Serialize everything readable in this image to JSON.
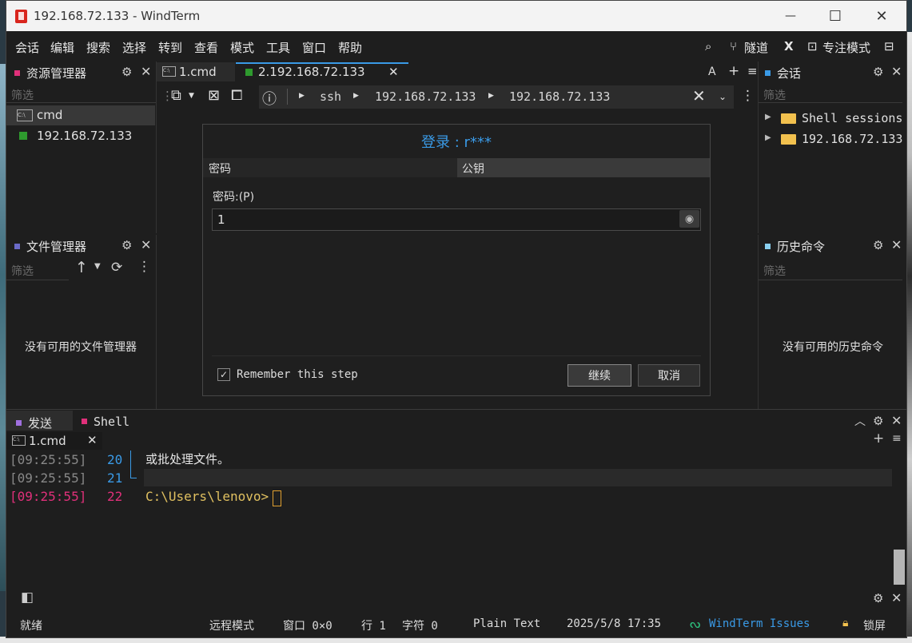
{
  "window": {
    "title": "192.168.72.133 - WindTerm",
    "minimize": "—",
    "maximize": "☐",
    "close": "✕"
  },
  "menu": [
    "会话",
    "编辑",
    "搜索",
    "选择",
    "转到",
    "查看",
    "模式",
    "工具",
    "窗口",
    "帮助"
  ],
  "toolbar_right": {
    "tunnel": "隧道",
    "focus_mode": "专注模式"
  },
  "resource_manager": {
    "title": "资源管理器",
    "filter": "筛选",
    "items": [
      "cmd",
      "192.168.72.133"
    ]
  },
  "file_manager": {
    "title": "文件管理器",
    "filter": "筛选",
    "empty": "没有可用的文件管理器"
  },
  "tabs": [
    {
      "label": "1.cmd"
    },
    {
      "label": "2.192.168.72.133"
    }
  ],
  "address": {
    "parts": [
      "ssh",
      "192.168.72.133",
      "192.168.72.133"
    ]
  },
  "dialog": {
    "title": "登录 : r***",
    "tab_password": "密码",
    "tab_publickey": "公钥",
    "password_label": "密码:(P)",
    "password_value": "1",
    "remember": "Remember this step",
    "ok": "继续",
    "cancel": "取消"
  },
  "sessions": {
    "title": "会话",
    "filter": "筛选",
    "items": [
      "Shell sessions",
      "192.168.72.133"
    ]
  },
  "history": {
    "title": "历史命令",
    "filter": "筛选",
    "empty": "没有可用的历史命令"
  },
  "bottom": {
    "tab_send": "发送",
    "tab_shell": "Shell",
    "subtab": "1.cmd",
    "lines": [
      {
        "time": "[09:25:55]",
        "num": "20",
        "text": "或批处理文件。"
      },
      {
        "time": "[09:25:55]",
        "num": "21",
        "text": ""
      },
      {
        "time": "[09:25:55]",
        "num": "22",
        "text": "C:\\Users\\lenovo>"
      }
    ]
  },
  "status": {
    "ready": "就绪",
    "remote_mode": "远程模式",
    "window": "窗口 0×0",
    "row": "行 1",
    "chars": "字符 0",
    "syntax": "Plain Text",
    "datetime": "2025/5/8 17:35",
    "issues": "WindTerm Issues",
    "lock": "锁屏"
  },
  "colors": {
    "accent": "#3a9ae6",
    "prompt": "#e0c060",
    "highlight_time": "#e0307a",
    "status_link": "#3a9ae6"
  }
}
